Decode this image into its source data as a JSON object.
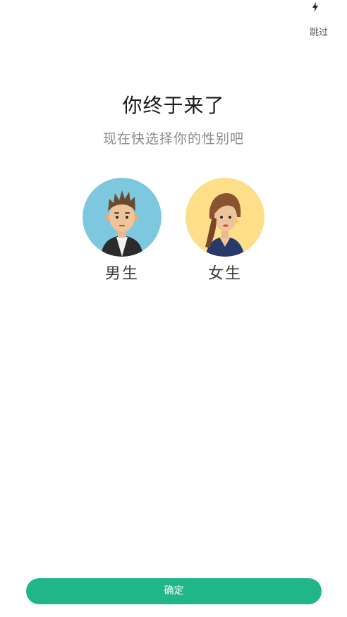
{
  "status_bar": {
    "icons": [
      "bolt-icon"
    ]
  },
  "header": {
    "skip_label": "跳过"
  },
  "main": {
    "title": "你终于来了",
    "subtitle": "现在快选择你的性别吧",
    "options": [
      {
        "label": "男生",
        "avatar_bg": "#7ec8df",
        "icon": "male-avatar-icon"
      },
      {
        "label": "女生",
        "avatar_bg": "#fddf8a",
        "icon": "female-avatar-icon"
      }
    ]
  },
  "footer": {
    "confirm_label": "确定",
    "accent": "#21b68a"
  }
}
